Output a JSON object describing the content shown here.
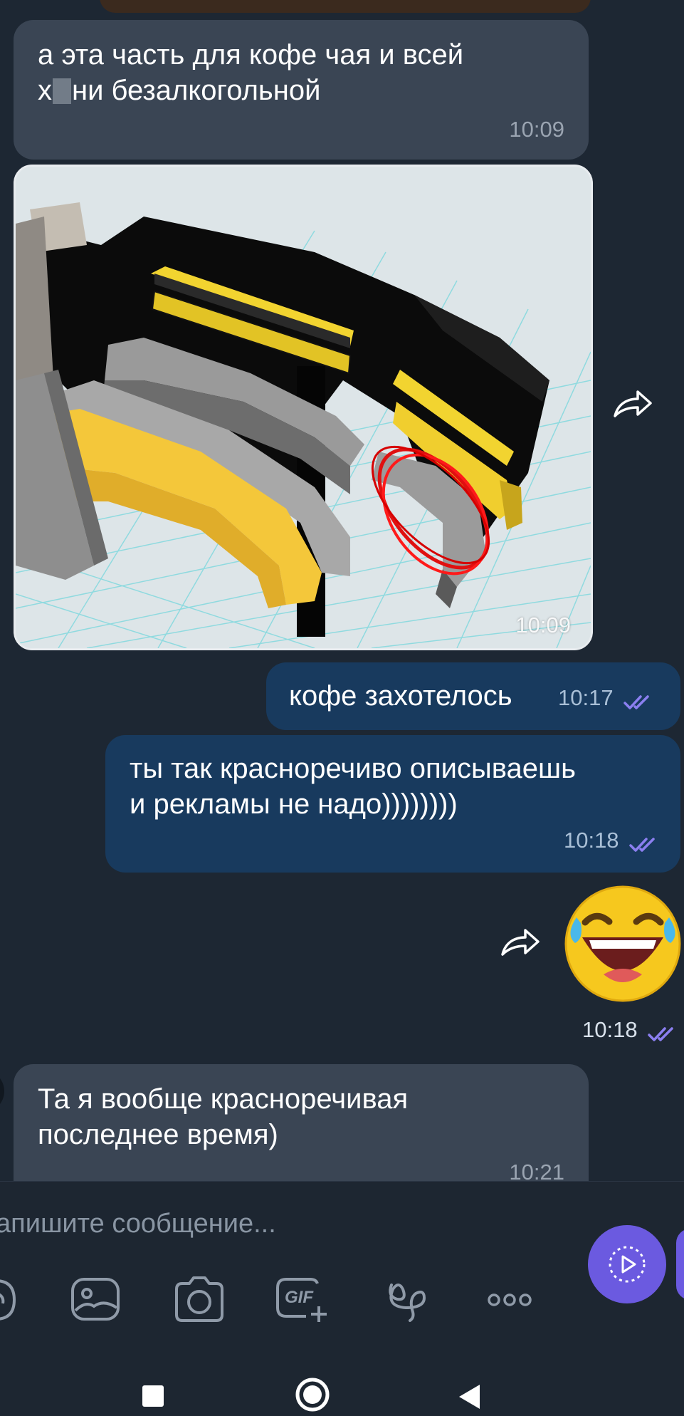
{
  "messages": {
    "m1": {
      "text_before": "а эта часть для кофе чая и всей",
      "text_line2_pre": "х",
      "text_line2_post": "ни безалкогольной",
      "time": "10:09"
    },
    "photo": {
      "time": "10:09"
    },
    "m3": {
      "text": "кофе захотелось",
      "time": "10:17"
    },
    "m4": {
      "line1": "ты так красноречиво описываешь",
      "line2": "и рекламы не надо))))))))",
      "time": "10:18"
    },
    "sticker": {
      "time": "10:18"
    },
    "m5": {
      "line1": "Та я вообще красноречивая",
      "line2": "последнее время)",
      "time": "10:21"
    }
  },
  "composer": {
    "placeholder": "апишите сообщение...",
    "gif_label": "GIF"
  },
  "icons": {
    "forward": "forward-arrow-icon",
    "read": "double-check-icon",
    "tools": [
      "sticker-icon",
      "gallery-icon",
      "camera-icon",
      "gif-icon",
      "doodle-icon",
      "more-icon"
    ],
    "send": "video-message-icon",
    "nav": [
      "recents-icon",
      "home-icon",
      "back-icon"
    ]
  },
  "colors": {
    "incoming": "#3a4554",
    "outgoing": "#183a5e",
    "accent": "#6b5ae0",
    "background": "#1d2733"
  }
}
